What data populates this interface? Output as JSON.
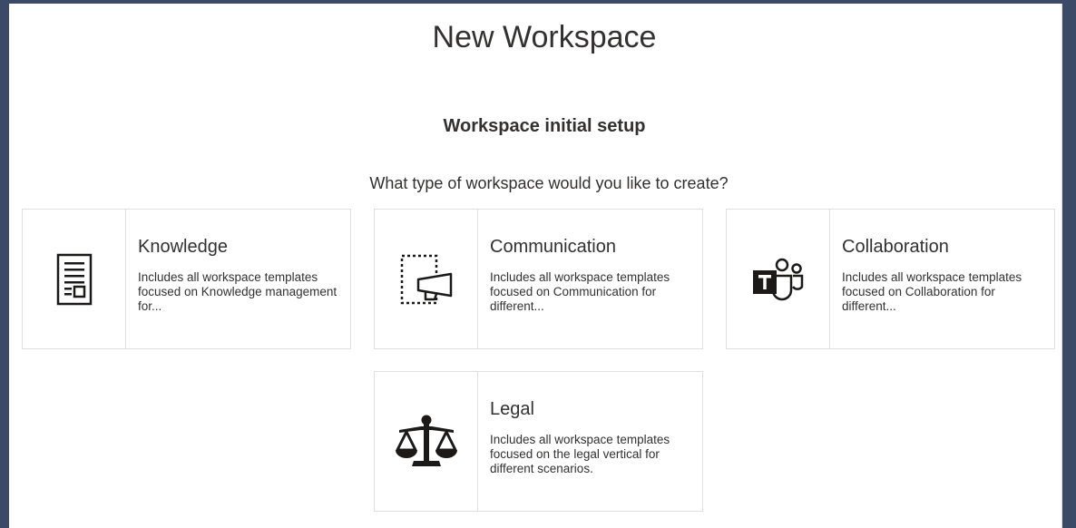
{
  "page": {
    "title": "New Workspace",
    "subtitle": "Workspace initial setup",
    "question": "What type of workspace would you like to create?"
  },
  "cards": [
    {
      "title": "Knowledge",
      "description": "Includes all workspace templates focused on Knowledge management for...",
      "icon": "document-layout-icon"
    },
    {
      "title": "Communication",
      "description": "Includes all workspace templates focused on Communication for different...",
      "icon": "megaphone-icon"
    },
    {
      "title": "Collaboration",
      "description": "Includes all workspace templates focused on Collaboration for different...",
      "icon": "teams-icon"
    },
    {
      "title": "Legal",
      "description": "Includes all workspace templates focused on the legal vertical for different scenarios.",
      "icon": "scales-icon"
    }
  ],
  "colors": {
    "background": "#3b4a66",
    "panel": "#ffffff",
    "border": "#e1dfdd",
    "text": "#323130"
  }
}
